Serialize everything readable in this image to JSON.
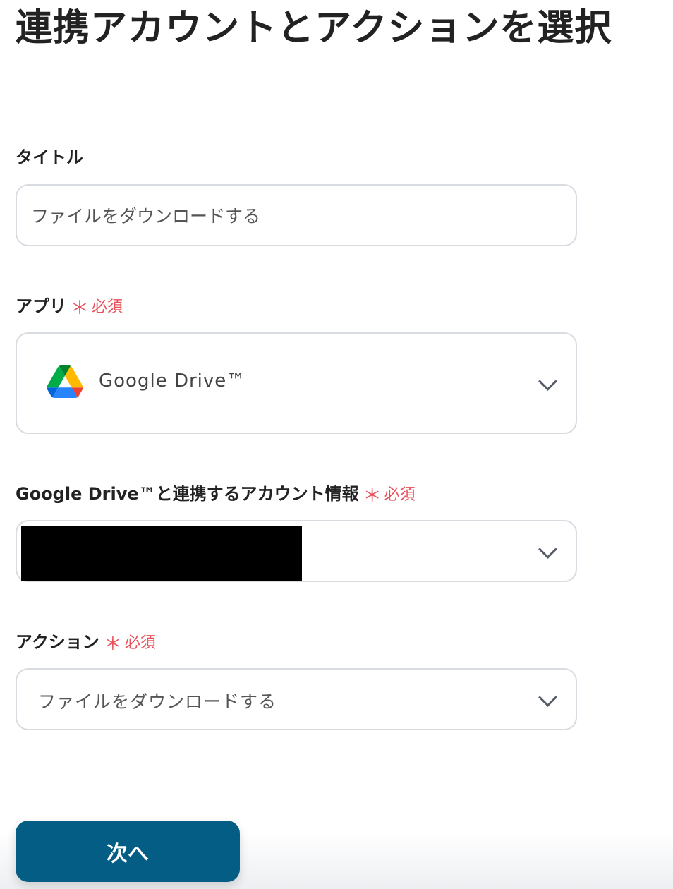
{
  "page": {
    "title": "連携アカウントとアクションを選択"
  },
  "fields": {
    "title": {
      "label": "タイトル",
      "value": "ファイルをダウンロードする"
    },
    "app": {
      "label": "アプリ",
      "required_mark": "＊",
      "required_text": "必須",
      "value": "Google Drive™",
      "icon": "google-drive-icon"
    },
    "account": {
      "label": "Google Drive™と連携するアカウント情報",
      "required_mark": "＊",
      "required_text": "必須",
      "value": ""
    },
    "action": {
      "label": "アクション",
      "required_mark": "＊",
      "required_text": "必須",
      "value": "ファイルをダウンロードする"
    }
  },
  "buttons": {
    "next_label": "次へ"
  },
  "colors": {
    "primary": "#045d85",
    "required": "#e8505b",
    "border": "#d8dbe0"
  }
}
